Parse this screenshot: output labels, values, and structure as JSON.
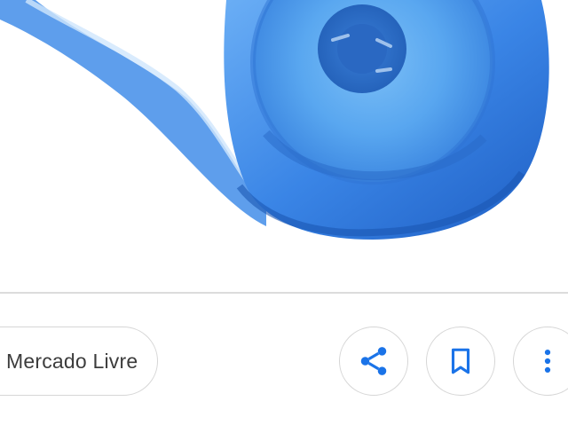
{
  "source": {
    "label": "Mercado Livre"
  },
  "actions": {
    "share_icon": "share-icon",
    "save_icon": "bookmark-icon",
    "more_icon": "more-vertical-icon"
  },
  "colors": {
    "accent": "#1a73e8",
    "chip_border": "#d6d6d6",
    "chip_text": "#3c3c3c",
    "divider": "#dcdcdc",
    "product_blue": "#3f86e8"
  }
}
